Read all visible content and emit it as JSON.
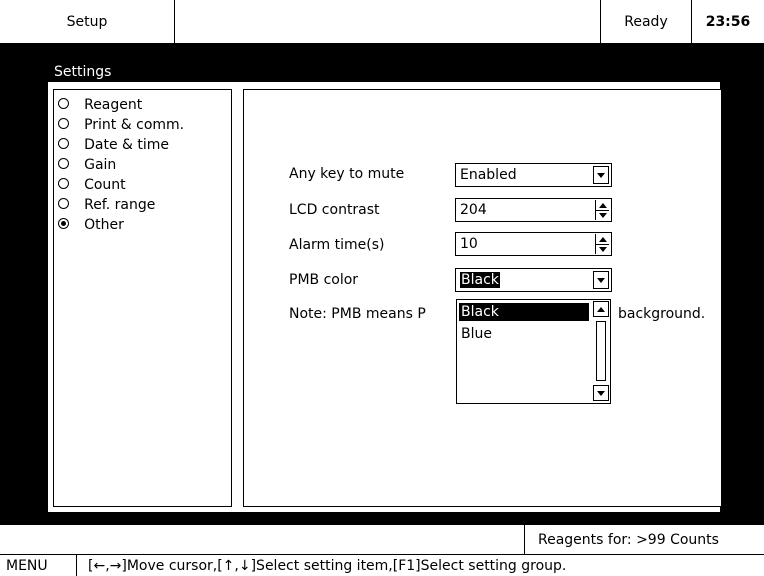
{
  "topbar": {
    "screen": "Setup",
    "status": "Ready",
    "time": "23:56"
  },
  "window": {
    "title": "Settings"
  },
  "groups": [
    {
      "label": "Reagent",
      "selected": false
    },
    {
      "label": "Print & comm.",
      "selected": false
    },
    {
      "label": "Date & time",
      "selected": false
    },
    {
      "label": "Gain",
      "selected": false
    },
    {
      "label": "Count",
      "selected": false
    },
    {
      "label": "Ref. range",
      "selected": false
    },
    {
      "label": "Other",
      "selected": true
    }
  ],
  "other": {
    "any_key_mute": {
      "label": "Any key to mute",
      "value": "Enabled"
    },
    "lcd_contrast": {
      "label": "LCD contrast",
      "value": "204"
    },
    "alarm_time": {
      "label": "Alarm time(s)",
      "value": "10"
    },
    "pmb_color": {
      "label": "PMB color",
      "value": "Black"
    },
    "note_left": "Note: PMB means P",
    "note_right": "background.",
    "dropdown_options": [
      "Black",
      "Blue"
    ]
  },
  "status_bar": {
    "reagents": "Reagents for: >99 Counts"
  },
  "hint_bar": {
    "menu": "MENU",
    "hint": "[←,→]Move cursor,[↑,↓]Select setting item,[F1]Select setting group."
  }
}
